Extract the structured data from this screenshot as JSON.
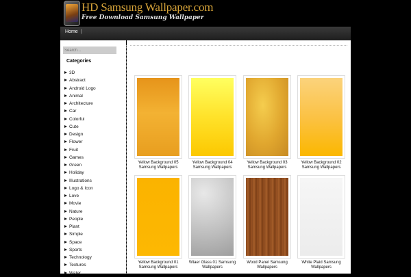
{
  "header": {
    "title": "HD Samsung Wallpaper.com",
    "tagline": "Free Download Samsung Wallpaper"
  },
  "nav": {
    "home": "Home",
    "separator": "|"
  },
  "sidebar": {
    "search_placeholder": "Search...",
    "categories_title": "Categories",
    "categories": [
      "3D",
      "Abstract",
      "Android Logo",
      "Animal",
      "Architecture",
      "Car",
      "Colorful",
      "Cute",
      "Design",
      "Flower",
      "Fruit",
      "Games",
      "Green",
      "Holiday",
      "Illustrations",
      "Logo & Icon",
      "Love",
      "Movie",
      "Nature",
      "People",
      "Plant",
      "Simple",
      "Space",
      "Sports",
      "Technology",
      "Textures",
      "Water"
    ]
  },
  "gallery": [
    {
      "caption": "Yellow Background 05 Samsung Wallpapers",
      "fill": "linear-gradient(#e6941a,#f3b233 45%,#e89e1f)"
    },
    {
      "caption": "Yellow Background 04 Samsung Wallpapers",
      "fill": "linear-gradient(#ffff60,#ffe22a 50%,#fcc800)"
    },
    {
      "caption": "Yellow Background 03 Samsung Wallpapers",
      "fill": "radial-gradient(ellipse at 40% 35%,#f5cd4e,#e0a62e 55%,#c78a22)"
    },
    {
      "caption": "Yellow Background 02 Samsung Wallpapers",
      "fill": "linear-gradient(#fbd37c,#fbc245 50%,#fbb700)"
    },
    {
      "caption": "Yellow Background 01 Samsung Wallpapers",
      "fill": "linear-gradient(#fbb300,#fdb802)"
    },
    {
      "caption": "Wtaer Glass 01 Samsung Wallpapers",
      "fill": "radial-gradient(circle at 30% 20%,#e8e8e8,#bdbdbd 60%,#9e9e9e)"
    },
    {
      "caption": "Wood Panel Samsung Wallpapers",
      "fill": "repeating-linear-gradient(90deg,#8a4a1e 0px,#a65e2a 3px,#7c3f16 6px,#9b5424 9px)"
    },
    {
      "caption": "White Plaid Samsung Wallpapers",
      "fill": "linear-gradient(#f6f6f6,#ececec)"
    }
  ]
}
